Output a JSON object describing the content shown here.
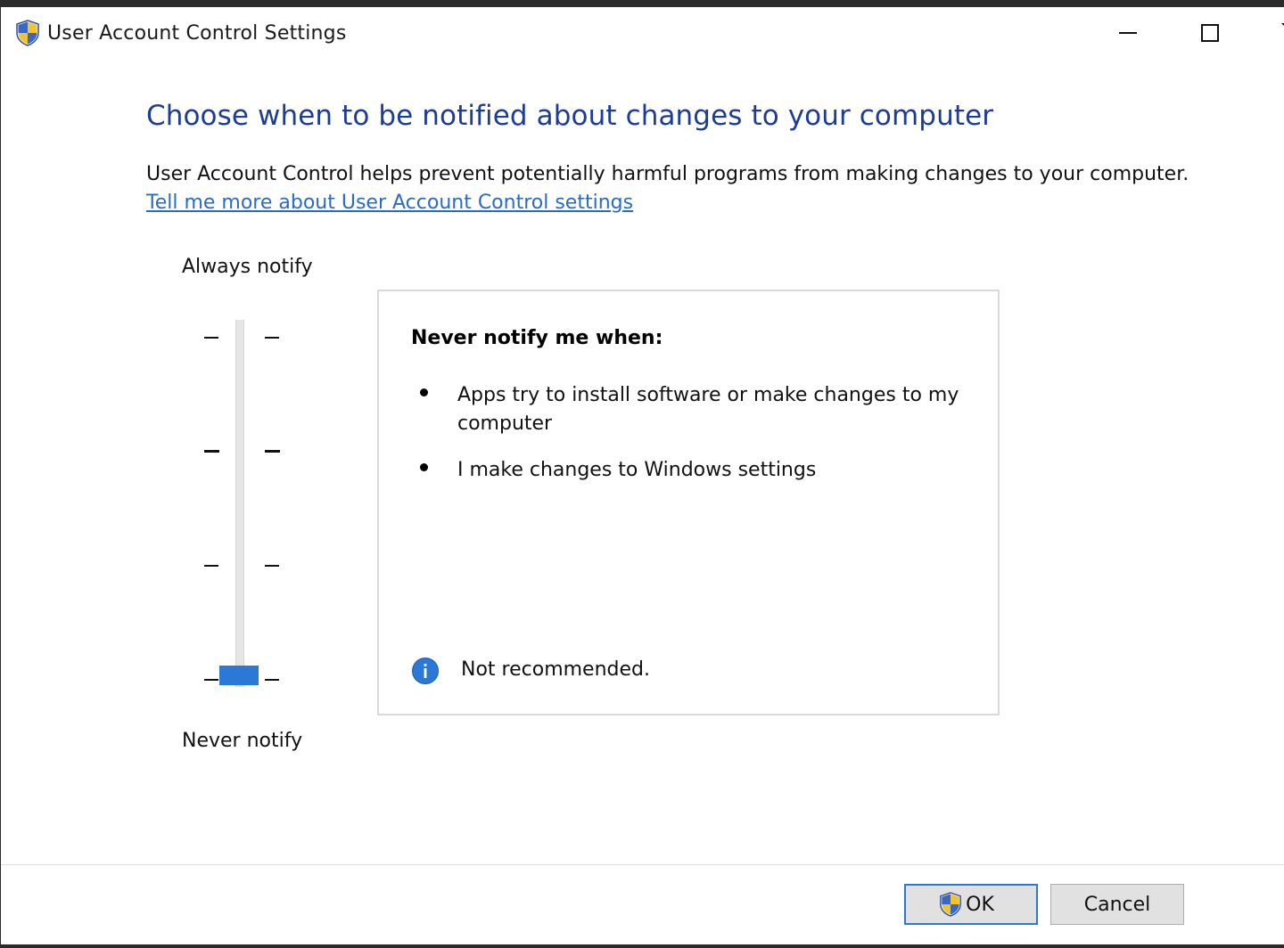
{
  "window": {
    "title": "User Account Control Settings",
    "title_icon": "uac-shield-icon"
  },
  "heading": "Choose when to be notified about changes to your computer",
  "description": "User Account Control helps prevent potentially harmful programs from making changes to your computer.",
  "learn_more_link": "Tell me more about User Account Control settings",
  "slider": {
    "top_label": "Always notify",
    "bottom_label": "Never notify",
    "levels": 4,
    "selected_level": 1,
    "accent_color": "#2b78d6"
  },
  "panel": {
    "heading": "Never notify me when:",
    "bullets": [
      "Apps try to install software or make changes to my computer",
      "I make changes to Windows settings"
    ],
    "recommendation_icon": "info-icon",
    "recommendation": "Not recommended."
  },
  "buttons": {
    "ok": "OK",
    "cancel": "Cancel"
  },
  "colors": {
    "heading": "#1c3d96",
    "link": "#2a6bc8"
  }
}
